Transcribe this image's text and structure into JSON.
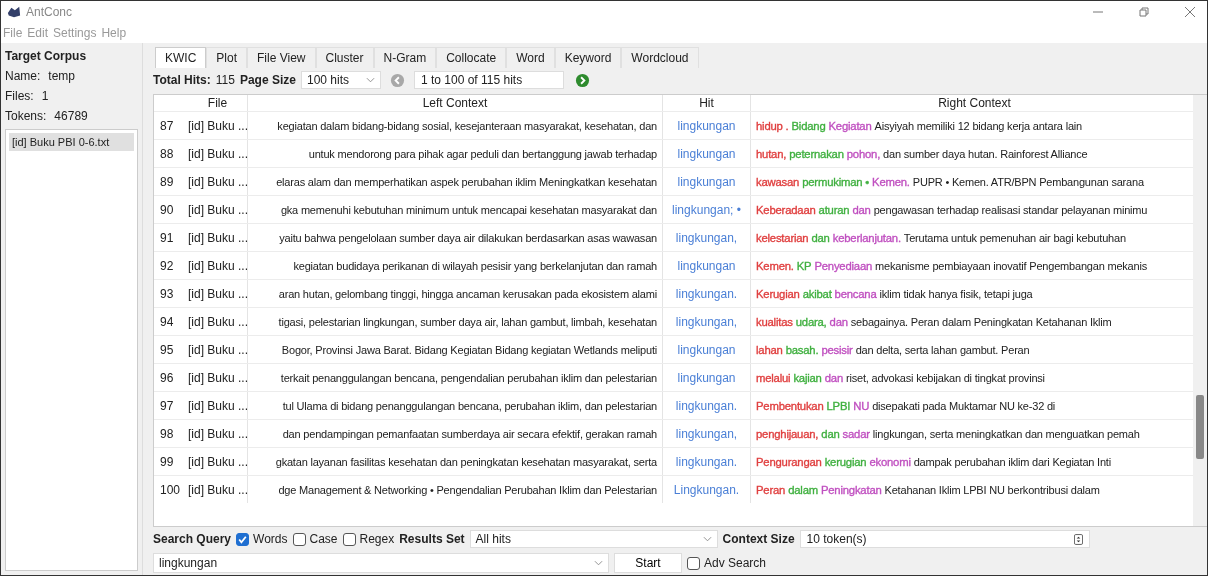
{
  "window": {
    "title": "AntConc"
  },
  "menu": [
    "File",
    "Edit",
    "Settings",
    "Help"
  ],
  "sidebar": {
    "heading": "Target Corpus",
    "fields": [
      {
        "label": "Name:",
        "value": "temp"
      },
      {
        "label": "Files:",
        "value": "1"
      },
      {
        "label": "Tokens:",
        "value": "46789"
      }
    ],
    "files": [
      {
        "name": "[id] Buku PBI 0-6.txt",
        "selected": true
      }
    ]
  },
  "tabs": [
    {
      "label": "KWIC",
      "selected": true
    },
    {
      "label": "Plot",
      "selected": false
    },
    {
      "label": "File View",
      "selected": false
    },
    {
      "label": "Cluster",
      "selected": false
    },
    {
      "label": "N-Gram",
      "selected": false
    },
    {
      "label": "Collocate",
      "selected": false
    },
    {
      "label": "Word",
      "selected": false
    },
    {
      "label": "Keyword",
      "selected": false
    },
    {
      "label": "Wordcloud",
      "selected": false
    }
  ],
  "toolbar": {
    "total_hits_label": "Total Hits:",
    "total_hits": "115",
    "page_size_label": "Page Size",
    "page_size": "100 hits",
    "range": "1 to 100 of 115 hits"
  },
  "table": {
    "columns": [
      "File",
      "Left Context",
      "Hit",
      "Right Context"
    ],
    "rows": [
      {
        "n": "87",
        "file": "[id] Buku ...",
        "left": "kegiatan dalam bidang-bidang sosial, kesejanteraan masyarakat, kesehatan, dan",
        "hit": "lingkungan",
        "right_tokens": [
          {
            "text": "hidup .",
            "color": "#e04040"
          },
          {
            "text": "Bidang",
            "color": "#40b040"
          },
          {
            "text": "Kegiatan",
            "color": "#c050c0"
          }
        ],
        "right_rest": "Aisyiyah memiliki 12 bidang kerja antara lain"
      },
      {
        "n": "88",
        "file": "[id] Buku ...",
        "left": "untuk mendorong para pihak agar peduli dan bertanggung jawab terhadap",
        "hit": "lingkungan",
        "right_tokens": [
          {
            "text": "hutan,",
            "color": "#e04040"
          },
          {
            "text": "peternakan",
            "color": "#40b040"
          },
          {
            "text": "pohon,",
            "color": "#c050c0"
          }
        ],
        "right_rest": "dan sumber daya hutan. Rainforest Alliance"
      },
      {
        "n": "89",
        "file": "[id] Buku ...",
        "left": "elaras alam dan memperhatikan aspek perubahan iklim Meningkatkan kesehatan",
        "hit": "lingkungan",
        "right_tokens": [
          {
            "text": "kawasan",
            "color": "#e04040"
          },
          {
            "text": "permukiman •",
            "color": "#40b040"
          },
          {
            "text": "Kemen.",
            "color": "#c050c0"
          }
        ],
        "right_rest": "PUPR • Kemen. ATR/BPN Pembangunan sarana"
      },
      {
        "n": "90",
        "file": "[id] Buku ...",
        "left": "gka memenuhi kebutuhan minimum untuk mencapai kesehatan masyarakat dan",
        "hit": "lingkungan; •",
        "right_tokens": [
          {
            "text": "Keberadaan",
            "color": "#e04040"
          },
          {
            "text": "aturan",
            "color": "#40b040"
          },
          {
            "text": "dan",
            "color": "#c050c0"
          }
        ],
        "right_rest": "pengawasan terhadap realisasi standar pelayanan minimu"
      },
      {
        "n": "91",
        "file": "[id] Buku ...",
        "left": "yaitu bahwa pengelolaan sumber daya air dilakukan berdasarkan asas wawasan",
        "hit": "lingkungan,",
        "right_tokens": [
          {
            "text": "kelestarian",
            "color": "#e04040"
          },
          {
            "text": "dan",
            "color": "#40b040"
          },
          {
            "text": "keberlanjutan.",
            "color": "#c050c0"
          }
        ],
        "right_rest": "Terutama untuk pemenuhan air bagi kebutuhan"
      },
      {
        "n": "92",
        "file": "[id] Buku ...",
        "left": "kegiatan budidaya perikanan di wilayah pesisir yang berkelanjutan dan ramah",
        "hit": "lingkungan",
        "right_tokens": [
          {
            "text": "Kemen.",
            "color": "#e04040"
          },
          {
            "text": "KP",
            "color": "#40b040"
          },
          {
            "text": "Penyediaan",
            "color": "#c050c0"
          }
        ],
        "right_rest": "mekanisme pembiayaan inovatif Pengembangan mekanis"
      },
      {
        "n": "93",
        "file": "[id] Buku ...",
        "left": "aran hutan, gelombang tinggi, hingga ancaman kerusakan pada ekosistem alami",
        "hit": "lingkungan.",
        "right_tokens": [
          {
            "text": "Kerugian",
            "color": "#e04040"
          },
          {
            "text": "akibat",
            "color": "#40b040"
          },
          {
            "text": "bencana",
            "color": "#c050c0"
          }
        ],
        "right_rest": "iklim tidak hanya fisik, tetapi juga"
      },
      {
        "n": "94",
        "file": "[id] Buku ...",
        "left": "tigasi, pelestarian lingkungan, sumber daya air, lahan gambut, limbah, kesehatan",
        "hit": "lingkungan,",
        "right_tokens": [
          {
            "text": "kualitas",
            "color": "#e04040"
          },
          {
            "text": "udara,",
            "color": "#40b040"
          },
          {
            "text": "dan",
            "color": "#c050c0"
          }
        ],
        "right_rest": "sebagainya. Peran dalam Peningkatan Ketahanan Iklim"
      },
      {
        "n": "95",
        "file": "[id] Buku ...",
        "left": "Bogor, Provinsi Jawa Barat. Bidang Kegiatan Bidang kegiatan Wetlands meliputi",
        "hit": "lingkungan",
        "right_tokens": [
          {
            "text": "lahan",
            "color": "#e04040"
          },
          {
            "text": "basah.",
            "color": "#40b040"
          },
          {
            "text": "pesisir",
            "color": "#c050c0"
          }
        ],
        "right_rest": "dan delta, serta lahan gambut. Peran"
      },
      {
        "n": "96",
        "file": "[id] Buku ...",
        "left": "terkait penanggulangan bencana, pengendalian perubahan iklim dan pelestarian",
        "hit": "lingkungan",
        "right_tokens": [
          {
            "text": "melalui",
            "color": "#e04040"
          },
          {
            "text": "kajian",
            "color": "#40b040"
          },
          {
            "text": "dan",
            "color": "#c050c0"
          }
        ],
        "right_rest": "riset, advokasi kebijakan di tingkat provinsi"
      },
      {
        "n": "97",
        "file": "[id] Buku ...",
        "left": "tul Ulama di bidang penanggulangan bencana, perubahan iklim, dan pelestarian",
        "hit": "lingkungan.",
        "right_tokens": [
          {
            "text": "Pembentukan",
            "color": "#e04040"
          },
          {
            "text": "LPBI",
            "color": "#40b040"
          },
          {
            "text": "NU",
            "color": "#c050c0"
          }
        ],
        "right_rest": "disepakati pada Muktamar NU ke-32 di"
      },
      {
        "n": "98",
        "file": "[id] Buku ...",
        "left": "dan pendampingan pemanfaatan sumberdaya air secara efektif, gerakan ramah",
        "hit": "lingkungan,",
        "right_tokens": [
          {
            "text": "penghijauan,",
            "color": "#e04040"
          },
          {
            "text": "dan",
            "color": "#40b040"
          },
          {
            "text": "sadar",
            "color": "#c050c0"
          }
        ],
        "right_rest": "lingkungan, serta meningkatkan dan menguatkan pemah"
      },
      {
        "n": "99",
        "file": "[id] Buku ...",
        "left": "gkatan layanan fasilitas kesehatan dan peningkatan kesehatan masyarakat, serta",
        "hit": "lingkungan.",
        "right_tokens": [
          {
            "text": "Pengurangan",
            "color": "#e04040"
          },
          {
            "text": "kerugian",
            "color": "#40b040"
          },
          {
            "text": "ekonomi",
            "color": "#c050c0"
          }
        ],
        "right_rest": "dampak perubahan iklim dari Kegiatan Inti"
      },
      {
        "n": "100",
        "file": "[id] Buku ...",
        "left": "dge Management & Networking • Pengendalian Perubahan Iklim dan Pelestarian",
        "hit": "Lingkungan.",
        "right_tokens": [
          {
            "text": "Peran",
            "color": "#e04040"
          },
          {
            "text": "dalam",
            "color": "#40b040"
          },
          {
            "text": "Peningkatan",
            "color": "#c050c0"
          }
        ],
        "right_rest": "Ketahanan Iklim LPBI NU berkontribusi dalam"
      }
    ]
  },
  "search": {
    "label": "Search Query",
    "options": [
      {
        "label": "Words",
        "checked": true
      },
      {
        "label": "Case",
        "checked": false
      },
      {
        "label": "Regex",
        "checked": false
      }
    ],
    "results_set_label": "Results Set",
    "results_set": "All hits",
    "context_size_label": "Context Size",
    "context_size": "10 token(s)",
    "query": "lingkungan",
    "start": "Start",
    "adv_search": {
      "label": "Adv Search",
      "checked": false
    }
  }
}
